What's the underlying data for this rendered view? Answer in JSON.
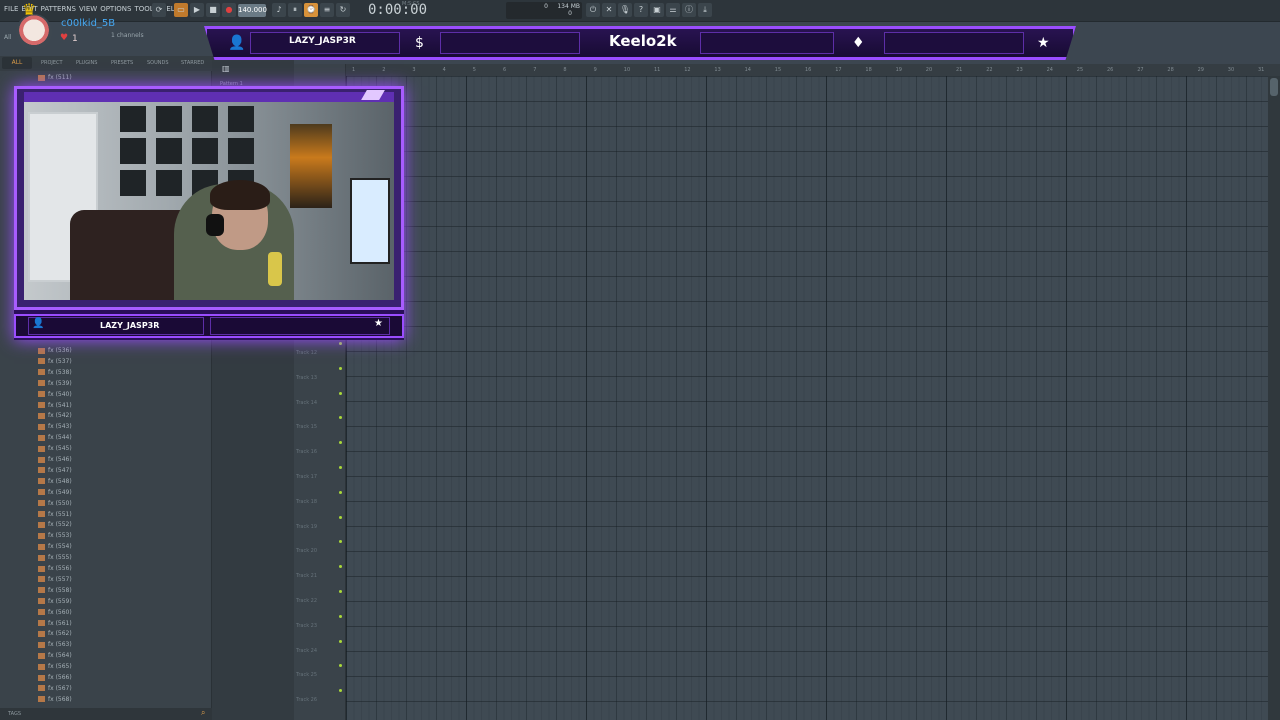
{
  "daw": {
    "menu": [
      "FILE",
      "EDIT",
      "PATTERNS",
      "VIEW",
      "OPTIONS",
      "TOOLS",
      "HELP"
    ],
    "tempo_label": "140.000",
    "time_display": "0:00:00",
    "time_sublabel": "M:S:CS",
    "cpu_value": "0",
    "memory_value": "134 MB",
    "voices_value": "0",
    "channels_label": "1 channels",
    "all_mini_label": "All"
  },
  "stream": {
    "chat_user": "c00lkid_5B",
    "user_count": "1",
    "banner_username": "LAZY_JASP3R",
    "banner_channel": "Keelo2k",
    "cam_username": "LAZY_JASP3R",
    "icons": [
      "user-icon",
      "dollar-icon",
      "diamond-icon",
      "star-icon"
    ],
    "accent_color": "#9a4dff"
  },
  "browser": {
    "tabs": [
      "ALL",
      "PROJECT",
      "PLUGINS",
      "PRESETS",
      "SOUNDS",
      "STARRED"
    ],
    "top_item": "fx (511)",
    "items": [
      "fx (536)",
      "fx (537)",
      "fx (538)",
      "fx (539)",
      "fx (540)",
      "fx (541)",
      "fx (542)",
      "fx (543)",
      "fx (544)",
      "fx (545)",
      "fx (546)",
      "fx (547)",
      "fx (548)",
      "fx (549)",
      "fx (550)",
      "fx (551)",
      "fx (552)",
      "fx (553)",
      "fx (554)",
      "fx (555)",
      "fx (556)",
      "fx (557)",
      "fx (558)",
      "fx (559)",
      "fx (560)",
      "fx (561)",
      "fx (562)",
      "fx (563)",
      "fx (564)",
      "fx (565)",
      "fx (566)",
      "fx (567)",
      "fx (568)"
    ],
    "footer_label": "TAGS"
  },
  "playlist": {
    "pattern_label": "Pattern 1",
    "track_labels": [
      "Track 12",
      "Track 13",
      "Track 14",
      "Track 15",
      "Track 16",
      "Track 17",
      "Track 18",
      "Track 19",
      "Track 20",
      "Track 21",
      "Track 22",
      "Track 23",
      "Track 24",
      "Track 25",
      "Track 26"
    ],
    "ruler_ticks": [
      "1",
      "2",
      "3",
      "4",
      "5",
      "6",
      "7",
      "8",
      "9",
      "10",
      "11",
      "12",
      "13",
      "14",
      "15",
      "16",
      "17",
      "18",
      "19",
      "20",
      "21",
      "22",
      "23",
      "24",
      "25",
      "26",
      "27",
      "28",
      "29",
      "30",
      "31"
    ]
  }
}
